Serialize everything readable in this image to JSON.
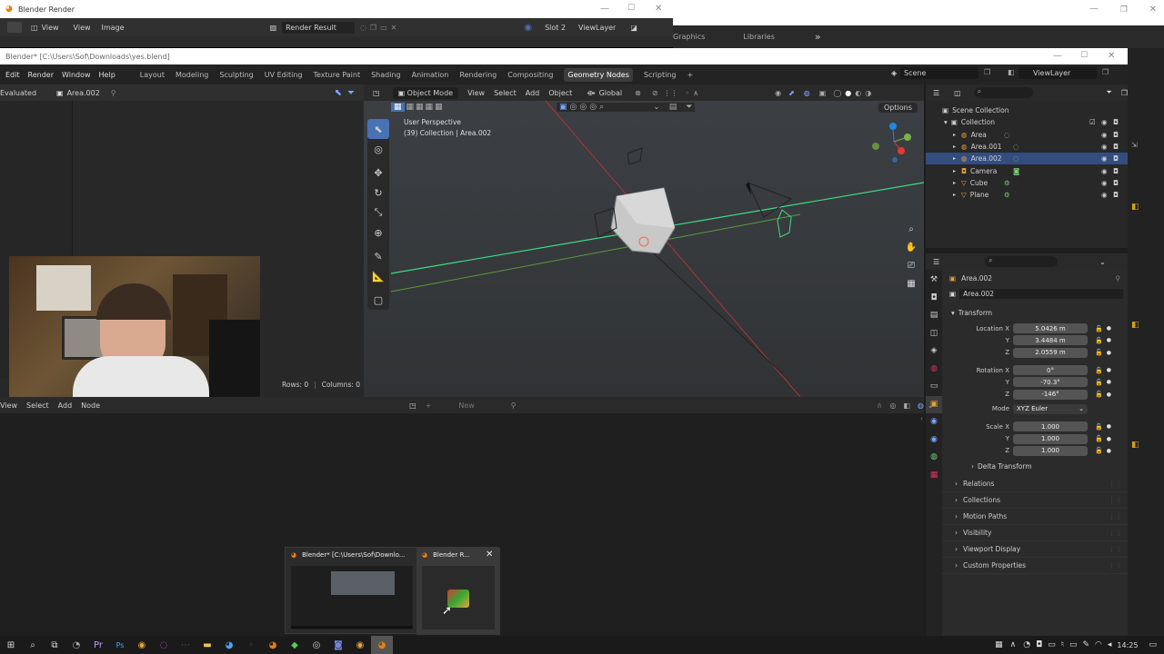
{
  "render_window": {
    "title": "Blender Render",
    "menu_view": "View",
    "menu_view2": "View",
    "menu_image": "Image",
    "image_name": "Render Result",
    "slot": "Slot 2",
    "layer": "ViewLayer"
  },
  "bg_window": {
    "tab1": "Graphics",
    "tab2": "Libraries",
    "more": "»"
  },
  "main_window": {
    "title": "Blender* [C:\\Users\\Sof\\Downloads\\yes.blend]"
  },
  "menubar": {
    "menus": [
      "Edit",
      "Render",
      "Window",
      "Help"
    ],
    "workspaces": [
      "Layout",
      "Modeling",
      "Sculpting",
      "UV Editing",
      "Texture Paint",
      "Shading",
      "Animation",
      "Rendering",
      "Compositing",
      "Geometry Nodes",
      "Scripting"
    ],
    "active_workspace": "Geometry Nodes",
    "add_workspace": "+",
    "scene_label": "Scene",
    "viewlayer_label": "ViewLayer"
  },
  "spreadsheet": {
    "evaluated": "Evaluated",
    "object_name": "Area.002",
    "rows": "Rows: 0",
    "columns": "Columns: 0"
  },
  "viewport": {
    "mode": "Object Mode",
    "menus": [
      "View",
      "Select",
      "Add",
      "Object"
    ],
    "orientation": "Global",
    "options": "Options",
    "info_line1": "User Perspective",
    "info_line2": "(39) Collection | Area.002"
  },
  "outliner": {
    "root": "Scene Collection",
    "collection": "Collection",
    "items": [
      {
        "name": "Area",
        "selected": false
      },
      {
        "name": "Area.001",
        "selected": false
      },
      {
        "name": "Area.002",
        "selected": true
      },
      {
        "name": "Camera",
        "selected": false
      },
      {
        "name": "Cube",
        "selected": false
      },
      {
        "name": "Plane",
        "selected": false
      }
    ]
  },
  "properties": {
    "object_title": "Area.002",
    "data_name": "Area.002",
    "transform_title": "Transform",
    "location": {
      "label": "Location X",
      "x": "5.0426 m",
      "y": "3.4484 m",
      "z": "2.0559 m"
    },
    "rotation": {
      "label": "Rotation X",
      "x": "0°",
      "y": "-70.3°",
      "z": "-146°"
    },
    "mode_label": "Mode",
    "mode_value": "XYZ Euler",
    "scale": {
      "label": "Scale X",
      "x": "1.000",
      "y": "1.000",
      "z": "1.000"
    },
    "axis_y": "Y",
    "axis_z": "Z",
    "delta": "Delta Transform",
    "panels": [
      "Relations",
      "Collections",
      "Motion Paths",
      "Visibility",
      "Viewport Display",
      "Custom Properties"
    ]
  },
  "node_editor": {
    "menus": [
      "View",
      "Select",
      "Add",
      "Node"
    ],
    "new_button": "New"
  },
  "popup": {
    "item1": "Blender* [C:\\Users\\Sof\\Downlo...",
    "item2": "Blender R..."
  },
  "taskbar": {
    "time": "14:25"
  },
  "colors": {
    "accent": "#4772b3",
    "selected_row": "#334d80",
    "wire_green": "#3ddc84",
    "axis_red": "#b0343a"
  }
}
